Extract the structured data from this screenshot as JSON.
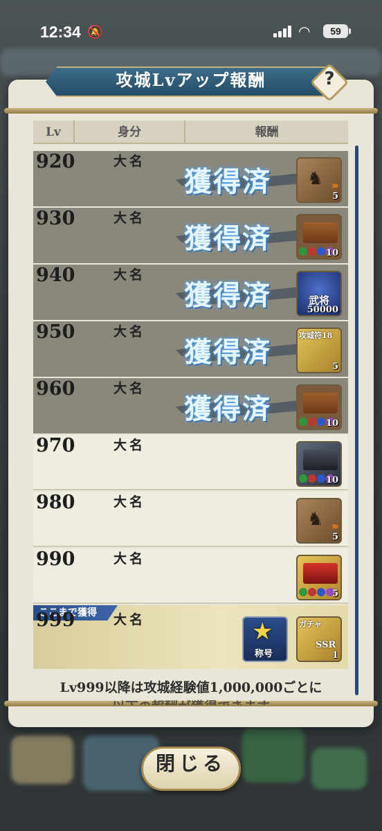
{
  "status_bar": {
    "time": "12:34",
    "battery": "59"
  },
  "dialog": {
    "title": "攻城Lvアップ報酬",
    "help_glyph": "?",
    "columns": {
      "lv": "Lv",
      "rank": "身分",
      "reward": "報酬"
    },
    "claimed_stamp": "獲得済",
    "rows": [
      {
        "lv": "920",
        "rank": "大名",
        "claimed": true,
        "item_count": "5"
      },
      {
        "lv": "930",
        "rank": "大名",
        "claimed": true,
        "item_count": "10"
      },
      {
        "lv": "940",
        "rank": "大名",
        "claimed": true,
        "item_label": "武将",
        "item_count": "50000"
      },
      {
        "lv": "950",
        "rank": "大名",
        "claimed": true,
        "item_label": "攻城符18",
        "item_count": "5"
      },
      {
        "lv": "960",
        "rank": "大名",
        "claimed": true,
        "item_count": "10"
      },
      {
        "lv": "970",
        "rank": "大名",
        "claimed": false,
        "item_count": "10"
      },
      {
        "lv": "980",
        "rank": "大名",
        "claimed": false,
        "item_count": "5"
      },
      {
        "lv": "990",
        "rank": "大名",
        "claimed": false,
        "item_count": "5"
      },
      {
        "lv": "999",
        "rank": "大名",
        "claimed": false,
        "title_item_label": "称号",
        "ticket_label": "ガチャ",
        "ticket_rarity": "SSR",
        "item_count": "1"
      }
    ],
    "earned_marker": "ここまで獲得",
    "note": "Lv999以降は攻城経験値1,000,000ごとに",
    "note_line2": "以下の報酬が獲得できます",
    "close_label": "閉じる"
  },
  "colors": {
    "panel": "#e9e6d8",
    "claimed_row": "#8a877b",
    "accent_blue": "#2b4d8a",
    "gold": "#c9b67e"
  }
}
